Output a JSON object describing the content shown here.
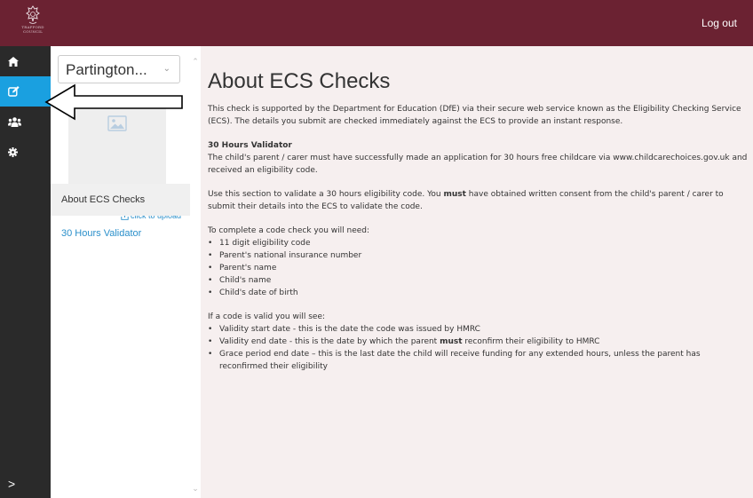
{
  "topbar": {
    "logo_icon": "crest-logo-icon",
    "logo_text_line1": "TRAFFORD",
    "logo_text_line2": "COUNCIL",
    "logout_label": "Log out",
    "color": "#6b2232"
  },
  "navrail": {
    "items": [
      {
        "icon": "home-icon"
      },
      {
        "icon": "edit-icon",
        "active": true
      },
      {
        "icon": "users-icon"
      },
      {
        "icon": "gear-icon"
      }
    ],
    "expand_label": ">",
    "active_color": "#1aa0e0"
  },
  "sidepanel": {
    "org_select_value": "Partington...",
    "avatar_icon": "image-placeholder-icon",
    "upload_label": "click to upload",
    "menu": [
      {
        "label": "About ECS Checks",
        "active": true
      },
      {
        "label": "30 Hours Validator"
      }
    ]
  },
  "content": {
    "title": "About ECS Checks",
    "intro": "This check is supported by the Department for Education (DfE) via their secure web service known as the Eligibility Checking Service (ECS).  The details you submit are checked immediately against the ECS to provide an instant response.",
    "validator_heading": "30 Hours Validator",
    "validator_text": "The child's parent / carer must have successfully made an application for 30 hours free childcare via www.childcarechoices.gov.uk and received an eligibility code.",
    "consent_pre": "Use this section to validate a 30 hours eligibility code. You ",
    "consent_bold": "must",
    "consent_post": " have obtained written consent from the child's parent / carer to submit their details into the ECS to validate the code.",
    "need_intro": "To complete a code check you will need:",
    "need_items": [
      "11 digit eligibility code",
      "Parent's national insurance number",
      "Parent's name",
      "Child's name",
      "Child's date of birth"
    ],
    "see_intro": "If a code is valid you will see:",
    "see_item1": "Validity start date - this is the date the code was issued by HMRC",
    "see_item2_pre": "Validity end date - this is the date by which the parent ",
    "see_item2_bold": "must",
    "see_item2_post": " reconfirm their eligibility to HMRC",
    "see_item3": "Grace period end date – this is the last date the child will receive funding for any extended hours, unless the parent has reconfirmed their eligibility",
    "background": "#f6efef"
  }
}
